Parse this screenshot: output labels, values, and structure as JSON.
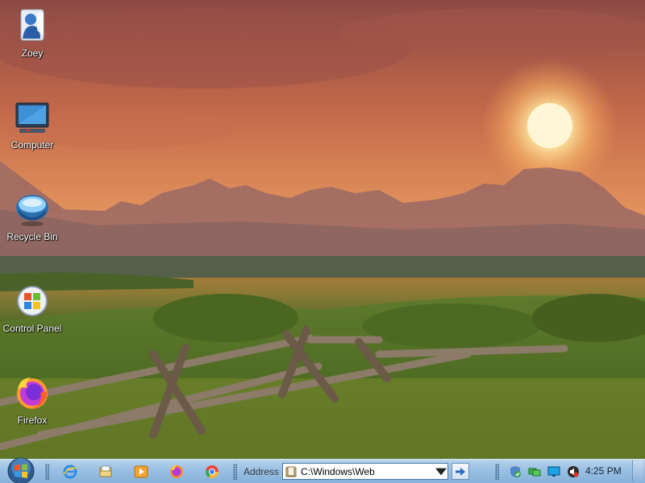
{
  "desktop": {
    "icons": [
      {
        "label": "Zoey",
        "icon": "user-folder-icon"
      },
      {
        "label": "Computer",
        "icon": "computer-icon"
      },
      {
        "label": "Recycle Bin",
        "icon": "recycle-bin-icon"
      },
      {
        "label": "Control Panel",
        "icon": "control-panel-icon"
      },
      {
        "label": "Firefox",
        "icon": "firefox-icon"
      }
    ]
  },
  "taskbar": {
    "start_icon": "windows-orb-icon",
    "quick_launch": [
      "internet-explorer-icon",
      "file-explorer-icon",
      "media-player-icon",
      "firefox-icon",
      "chrome-icon"
    ],
    "address_label": "Address",
    "address_value": "C:\\Windows\\Web",
    "tray_icons": [
      "security-shield-icon",
      "network-icon",
      "display-icon",
      "volume-icon"
    ],
    "clock": "4:25 PM"
  },
  "colors": {
    "taskbar_top": "#b7d3ec",
    "taskbar_bottom": "#86b1da",
    "sky_glow": "#f2a65a"
  }
}
